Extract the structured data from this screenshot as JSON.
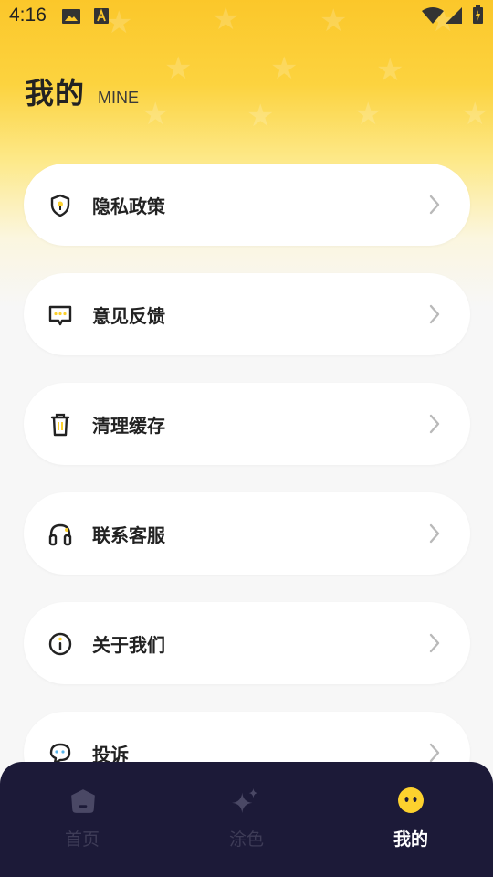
{
  "status_bar": {
    "time": "4:16",
    "icons": [
      "image-icon",
      "text-a-icon",
      "wifi-icon",
      "signal-icon",
      "battery-icon"
    ]
  },
  "header": {
    "title": "我的",
    "subtitle": "MINE"
  },
  "menu": {
    "items": [
      {
        "label": "隐私政策",
        "icon": "shield-icon"
      },
      {
        "label": "意见反馈",
        "icon": "feedback-icon"
      },
      {
        "label": "清理缓存",
        "icon": "trash-icon"
      },
      {
        "label": "联系客服",
        "icon": "headset-icon"
      },
      {
        "label": "关于我们",
        "icon": "info-icon"
      },
      {
        "label": "投诉",
        "icon": "complaint-icon"
      }
    ]
  },
  "tab_bar": {
    "tabs": [
      {
        "label": "首页",
        "icon": "home-icon",
        "active": false
      },
      {
        "label": "涂色",
        "icon": "sparkle-icon",
        "active": false
      },
      {
        "label": "我的",
        "icon": "face-icon",
        "active": true
      }
    ]
  },
  "colors": {
    "accent_yellow": "#fbc72a",
    "tab_bar_bg": "#1c1a38",
    "tab_active": "#ffffff",
    "tab_inactive": "#3e3c57",
    "icon_yellow": "#fcd12e"
  }
}
